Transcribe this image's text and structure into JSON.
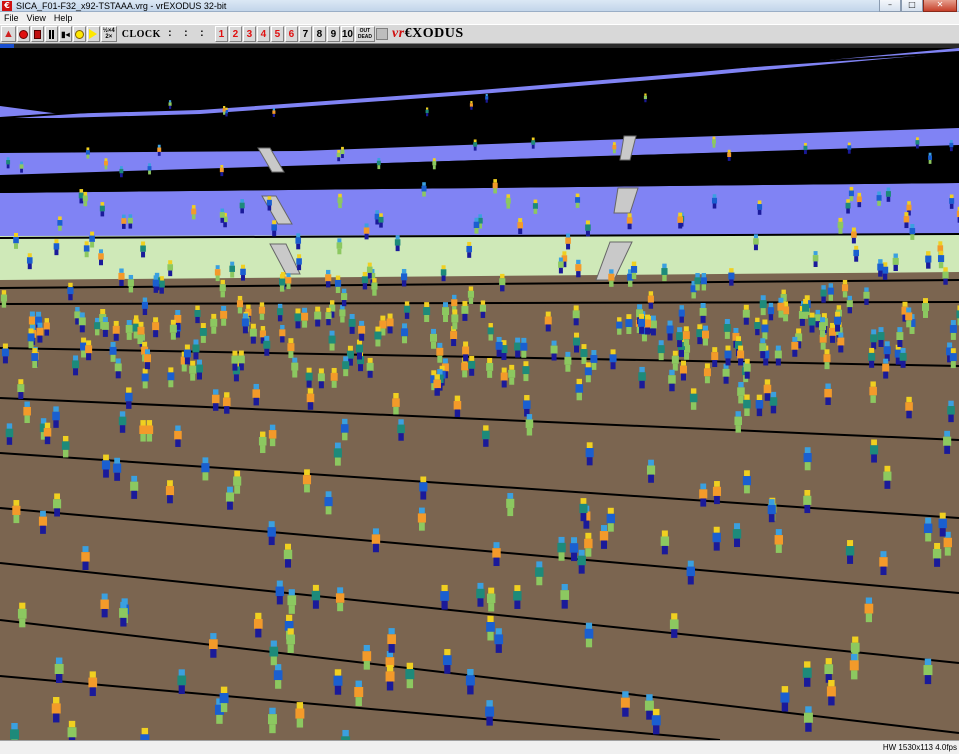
{
  "window": {
    "title": "SICA_F01-F32_x92-TSTAAA.vrg - vrEXODUS 32-bit",
    "app_icon_glyph": "€",
    "controls": {
      "minimize": "–",
      "maximize": "□",
      "close": "✕"
    }
  },
  "menu": {
    "items": [
      "File",
      "View",
      "Help"
    ]
  },
  "toolbar": {
    "clock_label": "CLOCK",
    "clock_value": ": : :",
    "speed_label_top": "½×4",
    "speed_label_bottom": "2×",
    "floor_buttons": [
      "1",
      "2",
      "3",
      "4",
      "5",
      "6",
      "7",
      "8",
      "9",
      "10"
    ],
    "floor_buttons_red": 6,
    "out_dead_top": "OUT",
    "out_dead_bottom": "DEAD",
    "brand_prefix": "vr",
    "brand_name": "€XODUS"
  },
  "colors": {
    "sky": "#000000",
    "wall_purple": "#8083f4",
    "floor_brown": "#7b6550",
    "pale_green": "#cfe9b8",
    "occupant_orange": "#f39a2a",
    "occupant_teal": "#1d8a7a",
    "occupant_blue": "#1a5fd0",
    "occupant_green": "#8cc860",
    "occupant_navy": "#1a1a9a"
  },
  "icons": [
    "warning-icon",
    "record-icon",
    "stop-icon",
    "pause-icon",
    "step-back-icon",
    "yellow-dot-icon",
    "play-icon"
  ],
  "statusbar": {
    "text": "HW 1530x113 4.0fps"
  }
}
